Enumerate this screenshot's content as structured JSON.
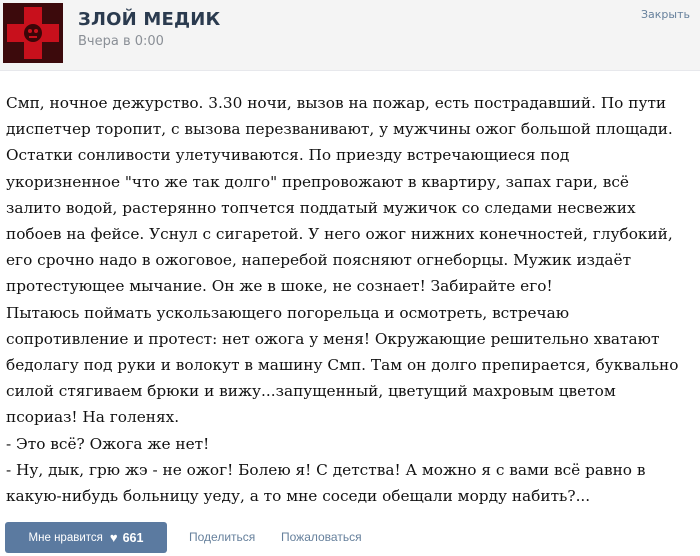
{
  "header": {
    "group_name": "ЗЛОЙ МЕДИК",
    "post_time": "Вчера в 0:00",
    "close_label": "Закрыть"
  },
  "post": {
    "lines": [
      "Смп, ночное дежурство. 3.30 ночи, вызов на пожар, есть пострадавший. По пути",
      "диспетчер торопит, с вызова перезванивают, у мужчины ожог большой площади.",
      "Остатки сонливости улетучиваются. По приезду встречающиеся под",
      "укоризненное \"что же так долго\" препровожают в квартиру, запах гари, всё",
      "залито водой, растерянно топчется поддатый мужичок со следами несвежих",
      "побоев на фейсе. Уснул с сигаретой. У него ожог нижних конечностей, глубокий,",
      "его срочно надо в ожоговое, наперебой поясняют огнеборцы. Мужик издаёт",
      "протестующее мычание. Он же в шоке, не сознает! Забирайте его!",
      "Пытаюсь поймать ускользающего погорельца и осмотреть, встречаю",
      "сопротивление и протест: нет ожога у меня! Окружающие решительно хватают",
      "бедолагу под руки и волокут в машину Смп. Там он долго препирается, буквально",
      "силой стягиваем брюки и вижу...запущенный, цветущий махровым цветом",
      "псориаз! На голенях.",
      "- Это всё? Ожога же нет!",
      "- Ну, дык, грю жэ - не ожог! Болею я! С детства! А можно я с вами всё равно в",
      "какую-нибудь больницу уеду, а то мне соседи обещали морду набить?..."
    ]
  },
  "footer": {
    "like_label": "Мне нравится",
    "like_icon": "heart-icon",
    "like_count": "661",
    "share_label": "Поделиться",
    "report_label": "Пожаловаться"
  },
  "colors": {
    "header_bg": "#f4f4f4",
    "group_name": "#2b3b4f",
    "link": "#66809c",
    "like_button_bg": "#5b7aa0",
    "avatar_bg": "#4a0d10",
    "avatar_cross": "#c8101c"
  }
}
